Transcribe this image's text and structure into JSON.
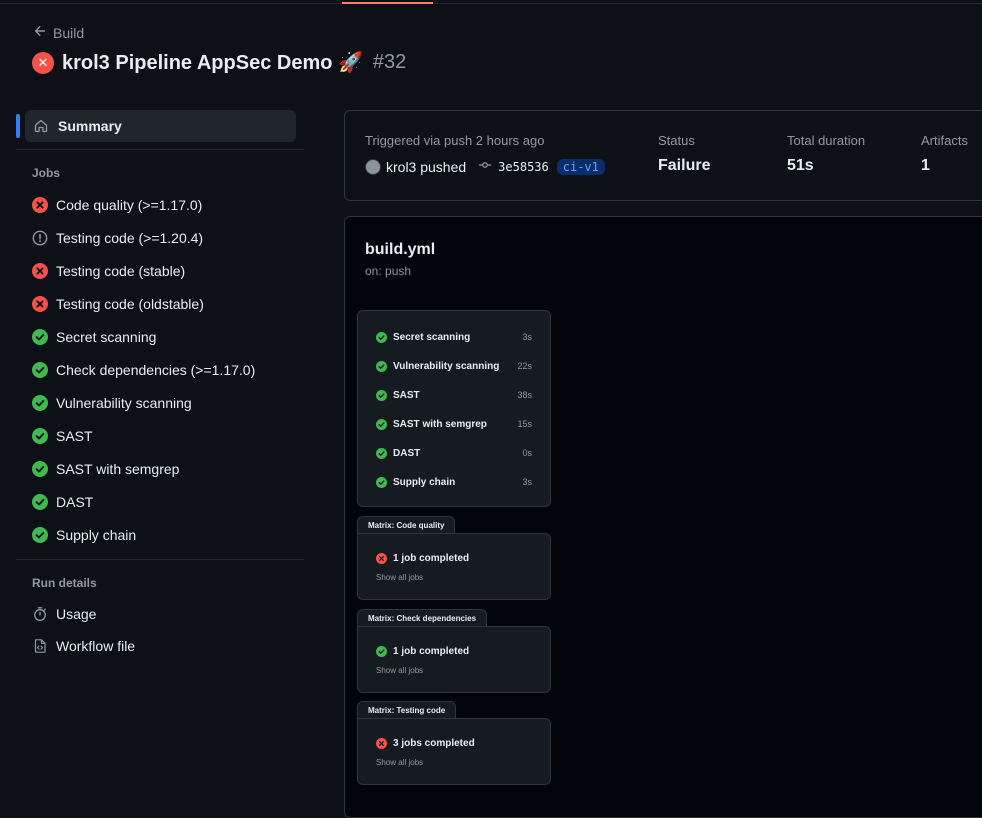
{
  "header": {
    "back_label": "Build",
    "title": "krol3 Pipeline AppSec Demo 🚀",
    "run_number": "#32"
  },
  "sidebar": {
    "summary_label": "Summary",
    "jobs_heading": "Jobs",
    "jobs": [
      {
        "label": "Code quality (>=1.17.0)",
        "status": "failure"
      },
      {
        "label": "Testing code (>=1.20.4)",
        "status": "warning"
      },
      {
        "label": "Testing code (stable)",
        "status": "failure"
      },
      {
        "label": "Testing code (oldstable)",
        "status": "failure"
      },
      {
        "label": "Secret scanning",
        "status": "success"
      },
      {
        "label": "Check dependencies (>=1.17.0)",
        "status": "success"
      },
      {
        "label": "Vulnerability scanning",
        "status": "success"
      },
      {
        "label": "SAST",
        "status": "success"
      },
      {
        "label": "SAST with semgrep",
        "status": "success"
      },
      {
        "label": "DAST",
        "status": "success"
      },
      {
        "label": "Supply chain",
        "status": "success"
      }
    ],
    "run_details_heading": "Run details",
    "usage_label": "Usage",
    "workflow_file_label": "Workflow file"
  },
  "summary_card": {
    "triggered_text": "Triggered via push 2 hours ago",
    "actor": "krol3 pushed",
    "commit_sha": "3e58536",
    "branch": "ci-v1",
    "status_label": "Status",
    "status_value": "Failure",
    "duration_label": "Total duration",
    "duration_value": "51s",
    "artifacts_label": "Artifacts",
    "artifacts_value": "1"
  },
  "workflow": {
    "file_name": "build.yml",
    "trigger": "on: push",
    "jobs": [
      {
        "label": "Secret scanning",
        "duration": "3s",
        "status": "success"
      },
      {
        "label": "Vulnerability scanning",
        "duration": "22s",
        "status": "success"
      },
      {
        "label": "SAST",
        "duration": "38s",
        "status": "success"
      },
      {
        "label": "SAST with semgrep",
        "duration": "15s",
        "status": "success"
      },
      {
        "label": "DAST",
        "duration": "0s",
        "status": "success"
      },
      {
        "label": "Supply chain",
        "duration": "3s",
        "status": "success"
      }
    ],
    "matrices": [
      {
        "tab": "Matrix: Code quality",
        "summary": "1 job completed",
        "link": "Show all jobs",
        "status": "failure"
      },
      {
        "tab": "Matrix: Check dependencies",
        "summary": "1 job completed",
        "link": "Show all jobs",
        "status": "success"
      },
      {
        "tab": "Matrix: Testing code",
        "summary": "3 jobs completed",
        "link": "Show all jobs",
        "status": "failure"
      }
    ]
  },
  "colors": {
    "success": "#3fb950",
    "failure": "#f85149",
    "warning": "#9198a1",
    "accent": "#2f81f7"
  }
}
